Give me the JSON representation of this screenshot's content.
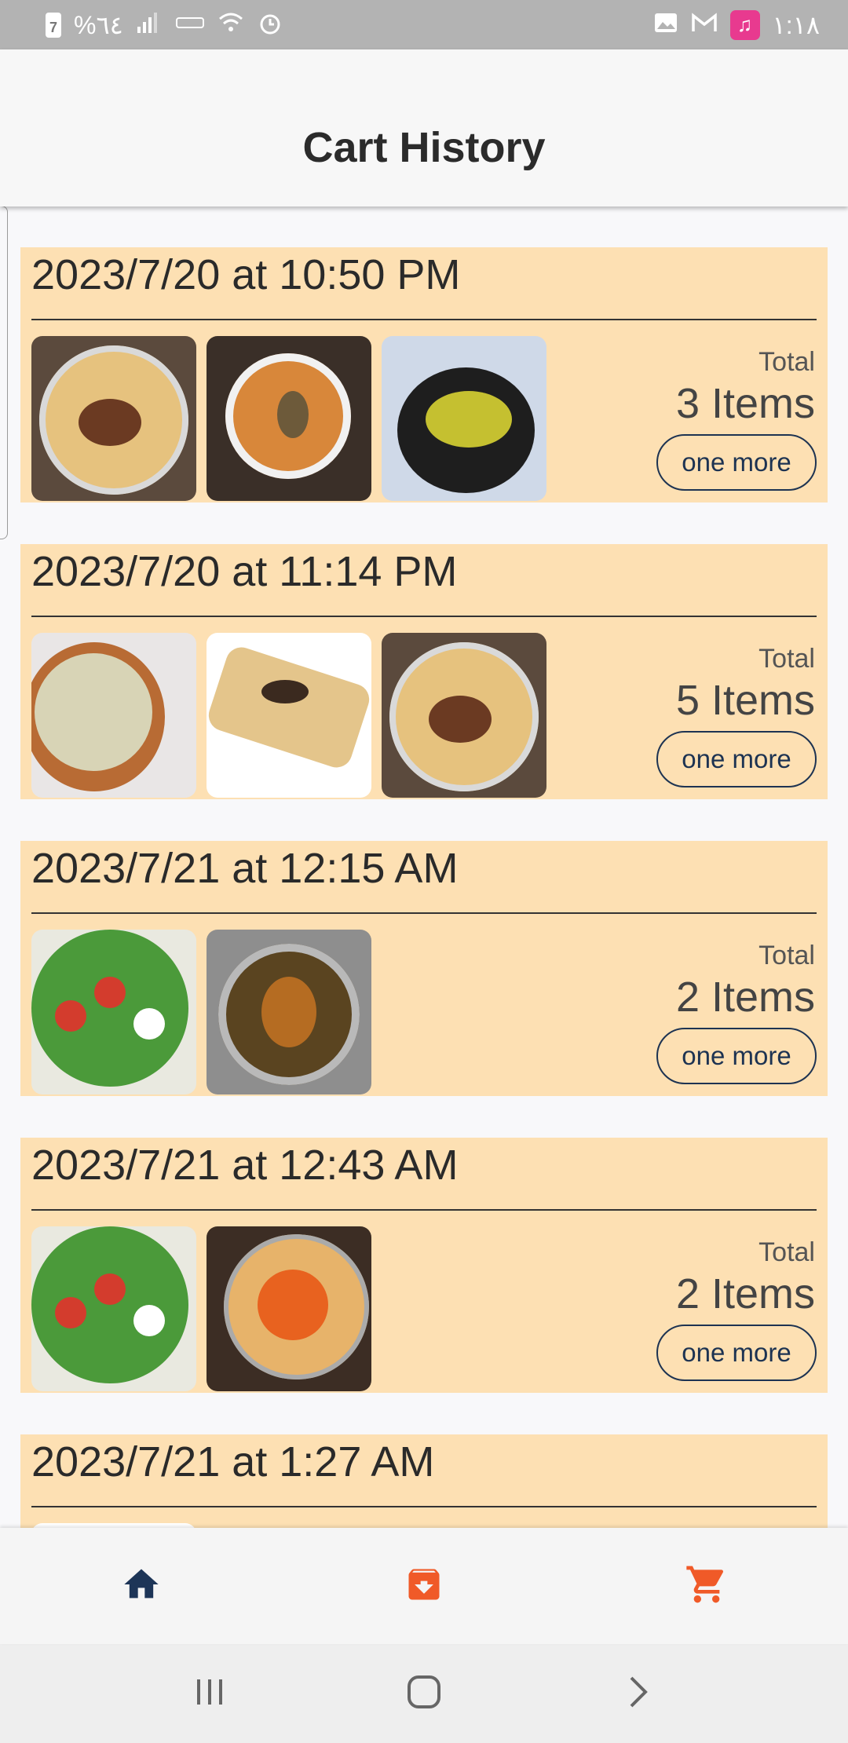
{
  "status_bar": {
    "left_text": "%٦٤",
    "time": "١:١٨",
    "battery_digit": "7"
  },
  "app_bar": {
    "title": "Cart History"
  },
  "labels": {
    "total": "Total",
    "one_more": "one more"
  },
  "cards": [
    {
      "date": "2023/7/20 at 10:50 PM",
      "items": "3 Items",
      "thumbs": [
        "plate-rice",
        "biryani",
        "stew-pot"
      ]
    },
    {
      "date": "2023/7/20 at 11:14 PM",
      "items": "5 Items",
      "thumbs": [
        "fried-rice",
        "pastry",
        "plate-rice"
      ]
    },
    {
      "date": "2023/7/21 at 12:15 AM",
      "items": "2 Items",
      "thumbs": [
        "salad",
        "fish-curry"
      ]
    },
    {
      "date": "2023/7/21 at 12:43 AM",
      "items": "2 Items",
      "thumbs": [
        "salad",
        "chicken-rice"
      ]
    },
    {
      "date": "2023/7/21 at 1:27 AM",
      "items": "",
      "thumbs": [
        "cut-off"
      ]
    }
  ],
  "bottom_nav": {
    "items": [
      {
        "icon": "home-icon",
        "color": "#1d3557"
      },
      {
        "icon": "archive-icon",
        "color": "#f05a28"
      },
      {
        "icon": "cart-icon",
        "color": "#f05a28"
      }
    ]
  },
  "system_nav": [
    "recents-icon",
    "home-circle-icon",
    "back-chevron-icon"
  ]
}
